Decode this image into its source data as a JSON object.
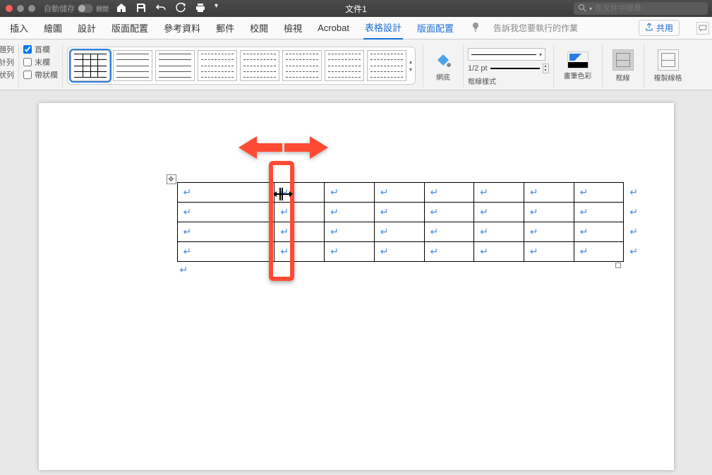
{
  "titlebar": {
    "autosave_label": "自動儲存",
    "autosave_state": "關閉",
    "doc_title": "文件1",
    "search_placeholder": "在文件中搜尋"
  },
  "tabs": {
    "insert": "插入",
    "draw": "繪圖",
    "design": "設計",
    "layout": "版面配置",
    "references": "參考資料",
    "mailings": "郵件",
    "review": "校閱",
    "view": "檢視",
    "acrobat": "Acrobat",
    "table_design": "表格設計",
    "table_layout": "版面配置",
    "tell_me": "告訴我您要執行的作業",
    "share": "共用"
  },
  "ribbon": {
    "opt_header_row_partial": "題列",
    "opt_total_row_partial": "計列",
    "opt_banded_rows_partial": "狀列",
    "opt_first_col": "首欄",
    "opt_last_col": "末欄",
    "opt_banded_cols": "帶狀欄",
    "shading": "網底",
    "border_styles": "框線樣式",
    "pen_weight": "1/2 pt",
    "pen_color": "畫筆色彩",
    "borders": "框線",
    "copy_border_partial": "複製線格"
  },
  "table": {
    "rows": 4,
    "cols": 8,
    "cell_mark": "↵"
  }
}
